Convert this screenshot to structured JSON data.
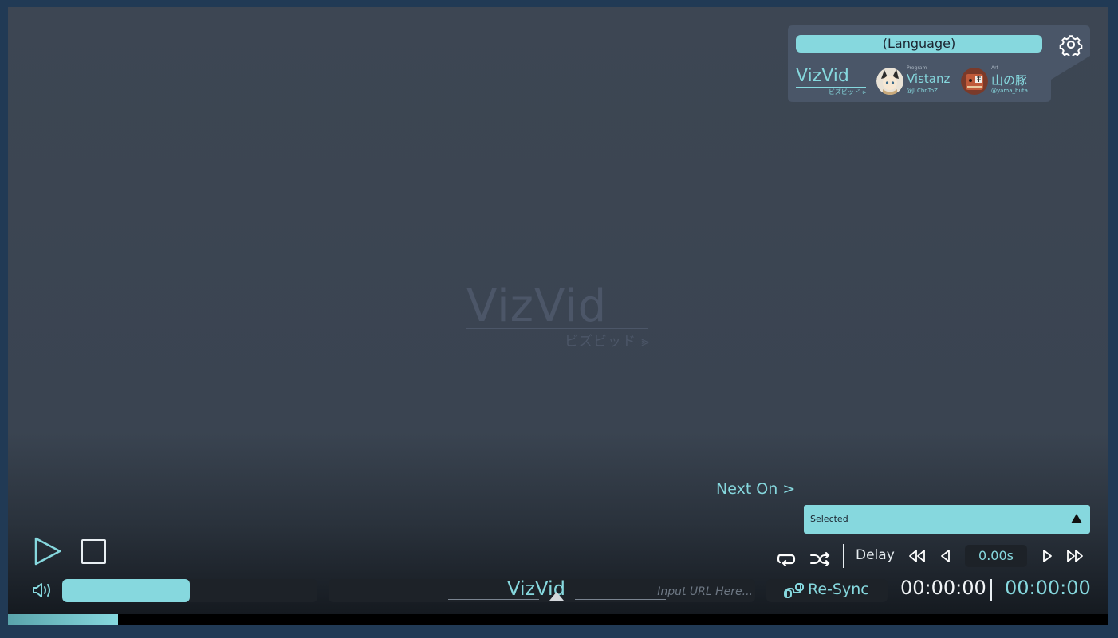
{
  "center_logo": {
    "title": "VizVid",
    "subtitle": "ビズビッド ⪢"
  },
  "panel": {
    "language_label": "(Language)",
    "mini_logo": {
      "title": "VizVid",
      "subtitle": "ビズビッド ⪢"
    },
    "credits": [
      {
        "role": "Program",
        "name": "Vistanz",
        "handle": "@JLChnToZ"
      },
      {
        "role": "Art",
        "name": "山の豚",
        "handle": "@yama_buta"
      }
    ]
  },
  "queue": {
    "next_on_label": "Next On >",
    "selected_value": "Selected"
  },
  "controls": {
    "delay_label": "Delay",
    "delay_value": "0.00s",
    "volume_level": 0.5,
    "url_logo": "VizVid",
    "url_placeholder": "Input URL Here...",
    "resync_label": "Re-Sync",
    "time_current": "00:00:00",
    "time_total": "00:00:00",
    "seek_progress": 0.1
  },
  "colors": {
    "accent": "#86d8de",
    "background": "#213a55",
    "panel": "#3d4653"
  },
  "icons": [
    "play-icon",
    "stop-icon",
    "loop-icon",
    "shuffle-icon",
    "rewind-fast-icon",
    "rewind-step-icon",
    "forward-step-icon",
    "forward-fast-icon",
    "volume-icon",
    "link-icon",
    "gear-icon"
  ]
}
